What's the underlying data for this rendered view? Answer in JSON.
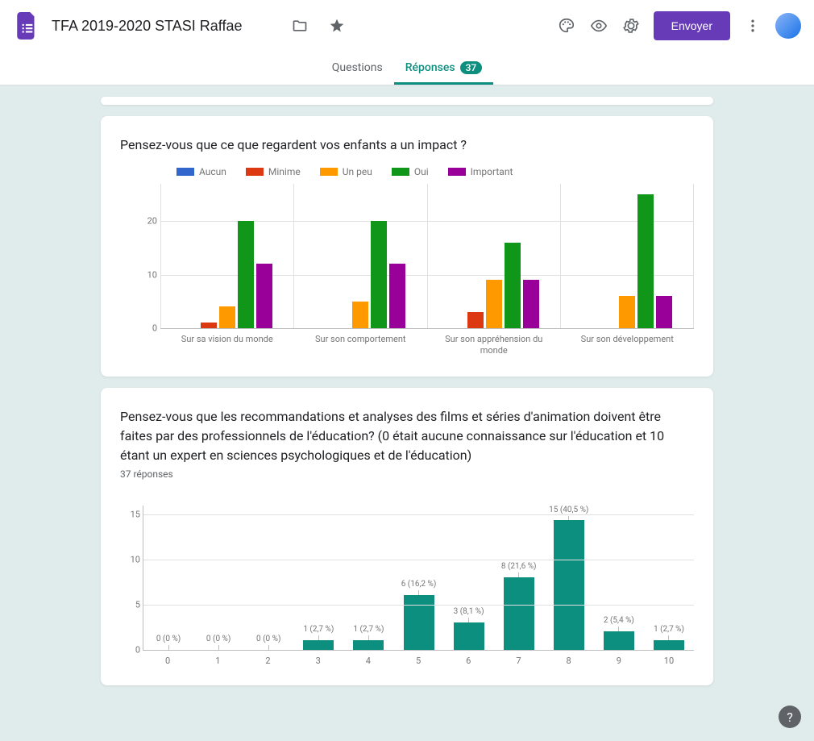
{
  "header": {
    "doc_title": "TFA 2019-2020 STASI Raffae",
    "send_label": "Envoyer"
  },
  "tabs": {
    "questions": "Questions",
    "responses": "Réponses",
    "badge": "37"
  },
  "card1": {
    "title": "Pensez-vous que ce que regardent vos enfants a un impact ?"
  },
  "card2": {
    "title": "Pensez-vous que les recommandations et analyses des films et séries d'animation doivent être faites par des professionnels de l'éducation? (0 était aucune connaissance sur l'éducation et 10 étant un expert en sciences psychologiques et de l'éducation)",
    "subtitle": "37 réponses"
  },
  "chart_data": [
    {
      "type": "bar",
      "title": "Pensez-vous que ce que regardent vos enfants a un impact ?",
      "categories": [
        "Sur sa vision du monde",
        "Sur son comportement",
        "Sur son appréhension du monde",
        "Sur son développement"
      ],
      "series": [
        {
          "name": "Aucun",
          "color": "#3366cc",
          "values": [
            0,
            0,
            0,
            0
          ]
        },
        {
          "name": "Minime",
          "color": "#dc3912",
          "values": [
            1,
            0,
            3,
            0
          ]
        },
        {
          "name": "Un peu",
          "color": "#ff9900",
          "values": [
            4,
            5,
            9,
            6
          ]
        },
        {
          "name": "Oui",
          "color": "#109618",
          "values": [
            20,
            20,
            16,
            25
          ]
        },
        {
          "name": "Important",
          "color": "#990099",
          "values": [
            12,
            12,
            9,
            6
          ]
        }
      ],
      "yticks": [
        0,
        10,
        20
      ],
      "ylim": [
        0,
        27
      ]
    },
    {
      "type": "bar",
      "title": "Pensez-vous que les recommandations et analyses des films et séries d'animation doivent être faites par des professionnels de l'éducation?",
      "categories": [
        "0",
        "1",
        "2",
        "3",
        "4",
        "5",
        "6",
        "7",
        "8",
        "9",
        "10"
      ],
      "values": [
        0,
        0,
        0,
        1,
        1,
        6,
        3,
        8,
        15,
        2,
        1
      ],
      "labels": [
        "0 (0 %)",
        "0 (0 %)",
        "0 (0 %)",
        "1 (2,7 %)",
        "1 (2,7 %)",
        "6 (16,2 %)",
        "3 (8,1 %)",
        "8 (21,6 %)",
        "15 (40,5 %)",
        "2 (5,4 %)",
        "1 (2,7 %)"
      ],
      "yticks": [
        0,
        5,
        10,
        15
      ],
      "ylim": [
        0,
        16
      ],
      "color": "#0d8f7f"
    }
  ]
}
